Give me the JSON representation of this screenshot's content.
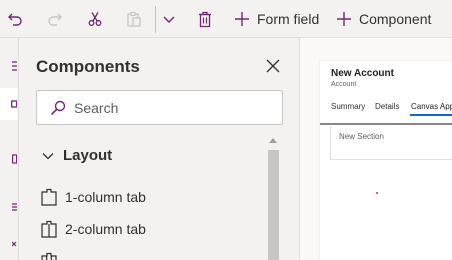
{
  "toolbar": {
    "undo": "undo-icon",
    "redo": "redo-icon",
    "cut": "cut-icon",
    "paste": "paste-icon",
    "more": "chevron-down-icon",
    "delete": "delete-icon",
    "form_field_label": "Form field",
    "component_label": "Component"
  },
  "panel": {
    "title": "Components",
    "search_placeholder": "Search",
    "section_label": "Layout",
    "items": [
      {
        "label": "1-column tab",
        "icon": "one-column-tab-icon"
      },
      {
        "label": "2-column tab",
        "icon": "two-column-tab-icon"
      }
    ]
  },
  "preview": {
    "title": "New Account",
    "subtitle": "Account",
    "tabs": [
      "Summary",
      "Details",
      "Canvas App"
    ],
    "active_tab": "Canvas App",
    "section_label": "New Section"
  },
  "colors": {
    "accent": "#742774",
    "tab_underline": "#0f6cbd",
    "background": "#f3f2f1"
  }
}
